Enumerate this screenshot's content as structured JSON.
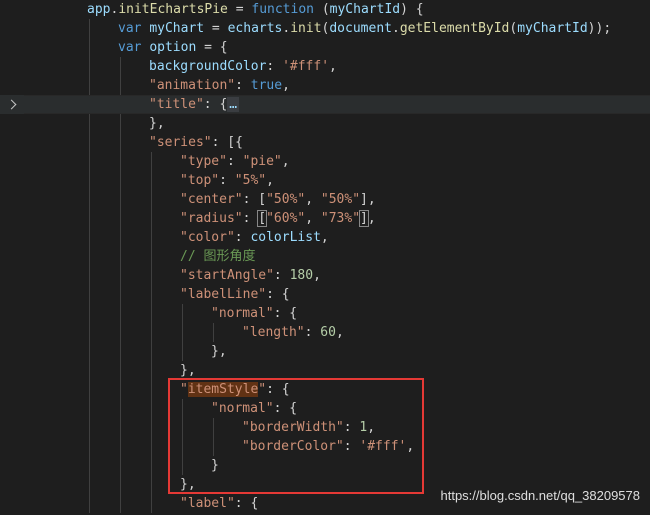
{
  "editor": {
    "lines": [
      {
        "indent": 0,
        "tokens": [
          [
            "var",
            "app"
          ],
          [
            "punc",
            "."
          ],
          [
            "fn",
            "initEchartsPie"
          ],
          [
            "punc",
            " = "
          ],
          [
            "kw",
            "function"
          ],
          [
            "punc",
            " ("
          ],
          [
            "var",
            "myChartId"
          ],
          [
            "punc",
            ") {"
          ]
        ]
      },
      {
        "indent": 1,
        "tokens": [
          [
            "kw",
            "var"
          ],
          [
            "punc",
            " "
          ],
          [
            "var",
            "myChart"
          ],
          [
            "punc",
            " = "
          ],
          [
            "var",
            "echarts"
          ],
          [
            "punc",
            "."
          ],
          [
            "fn",
            "init"
          ],
          [
            "punc",
            "("
          ],
          [
            "var",
            "document"
          ],
          [
            "punc",
            "."
          ],
          [
            "fn",
            "getElementById"
          ],
          [
            "punc",
            "("
          ],
          [
            "var",
            "myChartId"
          ],
          [
            "punc",
            "));"
          ]
        ]
      },
      {
        "indent": 1,
        "tokens": [
          [
            "kw",
            "var"
          ],
          [
            "punc",
            " "
          ],
          [
            "var",
            "option"
          ],
          [
            "punc",
            " = {"
          ]
        ]
      },
      {
        "indent": 2,
        "tokens": [
          [
            "var",
            "backgroundColor"
          ],
          [
            "punc",
            ": "
          ],
          [
            "str",
            "'#fff'"
          ],
          [
            "punc",
            ","
          ]
        ]
      },
      {
        "indent": 2,
        "tokens": [
          [
            "str",
            "\"animation\""
          ],
          [
            "punc",
            ": "
          ],
          [
            "kw",
            "true"
          ],
          [
            "punc",
            ","
          ]
        ]
      },
      {
        "indent": 2,
        "fold": true,
        "tokens": [
          [
            "str",
            "\"title\""
          ],
          [
            "punc",
            ": {"
          ],
          [
            "fold",
            "…"
          ]
        ]
      },
      {
        "indent": 2,
        "tokens": [
          [
            "punc",
            "},"
          ]
        ]
      },
      {
        "indent": 2,
        "tokens": [
          [
            "str",
            "\"series\""
          ],
          [
            "punc",
            ": [{"
          ]
        ]
      },
      {
        "indent": 3,
        "tokens": [
          [
            "str",
            "\"type\""
          ],
          [
            "punc",
            ": "
          ],
          [
            "str",
            "\"pie\""
          ],
          [
            "punc",
            ","
          ]
        ]
      },
      {
        "indent": 3,
        "tokens": [
          [
            "str",
            "\"top\""
          ],
          [
            "punc",
            ": "
          ],
          [
            "str",
            "\"5%\""
          ],
          [
            "punc",
            ","
          ]
        ]
      },
      {
        "indent": 3,
        "tokens": [
          [
            "str",
            "\"center\""
          ],
          [
            "punc",
            ": ["
          ],
          [
            "str",
            "\"50%\""
          ],
          [
            "punc",
            ", "
          ],
          [
            "str",
            "\"50%\""
          ],
          [
            "punc",
            "],"
          ]
        ]
      },
      {
        "indent": 3,
        "tokens": [
          [
            "str",
            "\"radius\""
          ],
          [
            "punc",
            ": "
          ],
          [
            "bracket",
            "["
          ],
          [
            "str",
            "\"60%\""
          ],
          [
            "punc",
            ", "
          ],
          [
            "str",
            "\"73%\""
          ],
          [
            "bracket",
            "]"
          ],
          [
            "punc",
            ","
          ]
        ]
      },
      {
        "indent": 3,
        "tokens": [
          [
            "str",
            "\"color\""
          ],
          [
            "punc",
            ": "
          ],
          [
            "var",
            "colorList"
          ],
          [
            "punc",
            ","
          ]
        ]
      },
      {
        "indent": 3,
        "tokens": [
          [
            "cmt",
            "// 图形角度"
          ]
        ]
      },
      {
        "indent": 3,
        "tokens": [
          [
            "str",
            "\"startAngle\""
          ],
          [
            "punc",
            ": "
          ],
          [
            "num",
            "180"
          ],
          [
            "punc",
            ","
          ]
        ]
      },
      {
        "indent": 3,
        "tokens": [
          [
            "str",
            "\"labelLine\""
          ],
          [
            "punc",
            ": {"
          ]
        ]
      },
      {
        "indent": 4,
        "tokens": [
          [
            "str",
            "\"normal\""
          ],
          [
            "punc",
            ": {"
          ]
        ]
      },
      {
        "indent": 5,
        "tokens": [
          [
            "str",
            "\"length\""
          ],
          [
            "punc",
            ": "
          ],
          [
            "num",
            "60"
          ],
          [
            "punc",
            ","
          ]
        ]
      },
      {
        "indent": 4,
        "tokens": [
          [
            "punc",
            "},"
          ]
        ]
      },
      {
        "indent": 3,
        "tokens": [
          [
            "punc",
            "},"
          ]
        ]
      },
      {
        "indent": 3,
        "tokens": [
          [
            "str",
            "\""
          ],
          [
            "hl",
            "itemStyle"
          ],
          [
            "str",
            "\""
          ],
          [
            "punc",
            ": {"
          ]
        ]
      },
      {
        "indent": 4,
        "tokens": [
          [
            "str",
            "\"normal\""
          ],
          [
            "punc",
            ": {"
          ]
        ]
      },
      {
        "indent": 5,
        "tokens": [
          [
            "str",
            "\"borderWidth\""
          ],
          [
            "punc",
            ": "
          ],
          [
            "num",
            "1"
          ],
          [
            "punc",
            ","
          ]
        ]
      },
      {
        "indent": 5,
        "tokens": [
          [
            "str",
            "\"borderColor\""
          ],
          [
            "punc",
            ": "
          ],
          [
            "str",
            "'#fff'"
          ],
          [
            "punc",
            ","
          ]
        ]
      },
      {
        "indent": 4,
        "tokens": [
          [
            "punc",
            "}"
          ]
        ]
      },
      {
        "indent": 3,
        "tokens": [
          [
            "punc",
            "},"
          ]
        ]
      },
      {
        "indent": 3,
        "tokens": [
          [
            "str",
            "\"label\""
          ],
          [
            "punc",
            ": {"
          ]
        ]
      }
    ]
  },
  "watermark": "https://blog.csdn.net/qq_38209578",
  "colors": {
    "background": "#1e1e1e",
    "keyword": "#569cd6",
    "function": "#dcdcaa",
    "variable": "#9cdcfe",
    "string": "#ce9178",
    "number": "#b5cea8",
    "comment": "#6a9955",
    "highlight_box": "#e53935"
  }
}
